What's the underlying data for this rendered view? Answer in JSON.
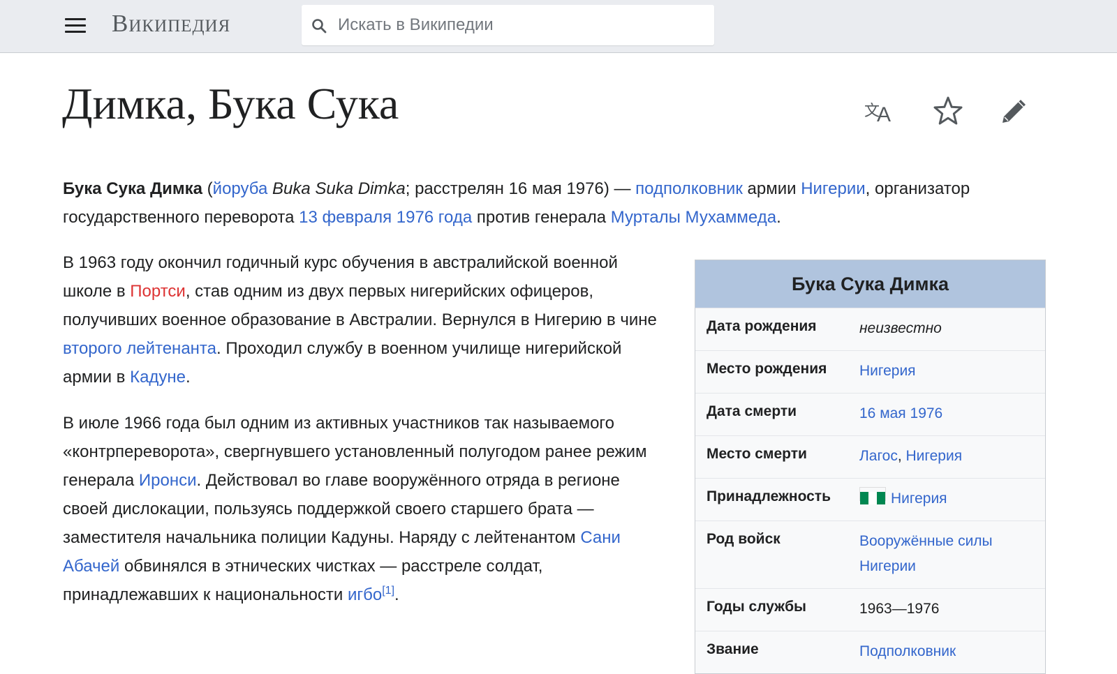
{
  "header": {
    "logo": "Википедия",
    "search_placeholder": "Искать в Википедии"
  },
  "page": {
    "title": "Димка, Бука Сука"
  },
  "lead": {
    "name_bold": "Бука Сука Димка",
    "open_paren": " (",
    "lang_link": "йоруба",
    "native_name": "Buka Suka Dimka",
    "text1": "; расстрелян 16 мая 1976) — ",
    "rank_link": "подполковник",
    "text2": " армии ",
    "country_link": "Нигерии",
    "text3": ", организатор государственного переворота ",
    "coup_link": "13 февраля 1976 года",
    "text4": " против генерала ",
    "general_link": "Мурталы Мухаммеда",
    "text5": "."
  },
  "para1": {
    "t1": "В 1963 году окончил годичный курс обучения в австралийской военной школе в ",
    "portsea_link": "Портси",
    "t2": ", став одним из двух первых нигерийских офицеров, получивших военное образование в Австралии. Вернулся в Нигерию в чине ",
    "lieut_link": "второго лейтенанта",
    "t3": ". Проходил службу в военном училище нигерийской армии в ",
    "kaduna_link": "Кадуне",
    "t4": "."
  },
  "para2": {
    "t1": "В июле 1966 года был одним из активных участников так называемого «контрпереворота», свергнувшего установленный полугодом ранее режим генерала ",
    "ironsi_link": "Иронси",
    "t2": ". Действовал во главе вооружённого отряда в регионе своей дислокации, пользуясь поддержкой своего старшего брата — заместителя начальника полиции Кадуны. Наряду с лейтенантом ",
    "abacha_link": "Сани Абачей",
    "t3": " обвинялся в этнических чистках — расстреле солдат, принадлежавших к национальности ",
    "igbo_link": "игбо",
    "ref": "[1]",
    "t4": "."
  },
  "infobox": {
    "title": "Бука Сука Димка",
    "rows": [
      {
        "label": "Дата рождения",
        "value": "неизвестно"
      },
      {
        "label": "Место рождения",
        "value": "Нигерия"
      },
      {
        "label": "Дата смерти",
        "value": "16 мая 1976"
      },
      {
        "label": "Место смерти",
        "value_a": "Лагос",
        "sep": ", ",
        "value_b": "Нигерия"
      },
      {
        "label": "Принадлежность",
        "value": "Нигерия"
      },
      {
        "label": "Род войск",
        "value_line1": "Вооружённые силы",
        "value_line2": "Нигерии"
      },
      {
        "label": "Годы службы",
        "value": "1963—1976"
      },
      {
        "label": "Звание",
        "value": "Подполковник"
      }
    ]
  },
  "colors": {
    "link": "#3366cc",
    "redlink": "#dd3333",
    "infobox_header": "#b0c4de",
    "flag_green": "#008751"
  },
  "icons": [
    "menu-icon",
    "search-icon",
    "language-icon",
    "star-icon",
    "edit-pencil-icon",
    "nigeria-flag-icon"
  ]
}
